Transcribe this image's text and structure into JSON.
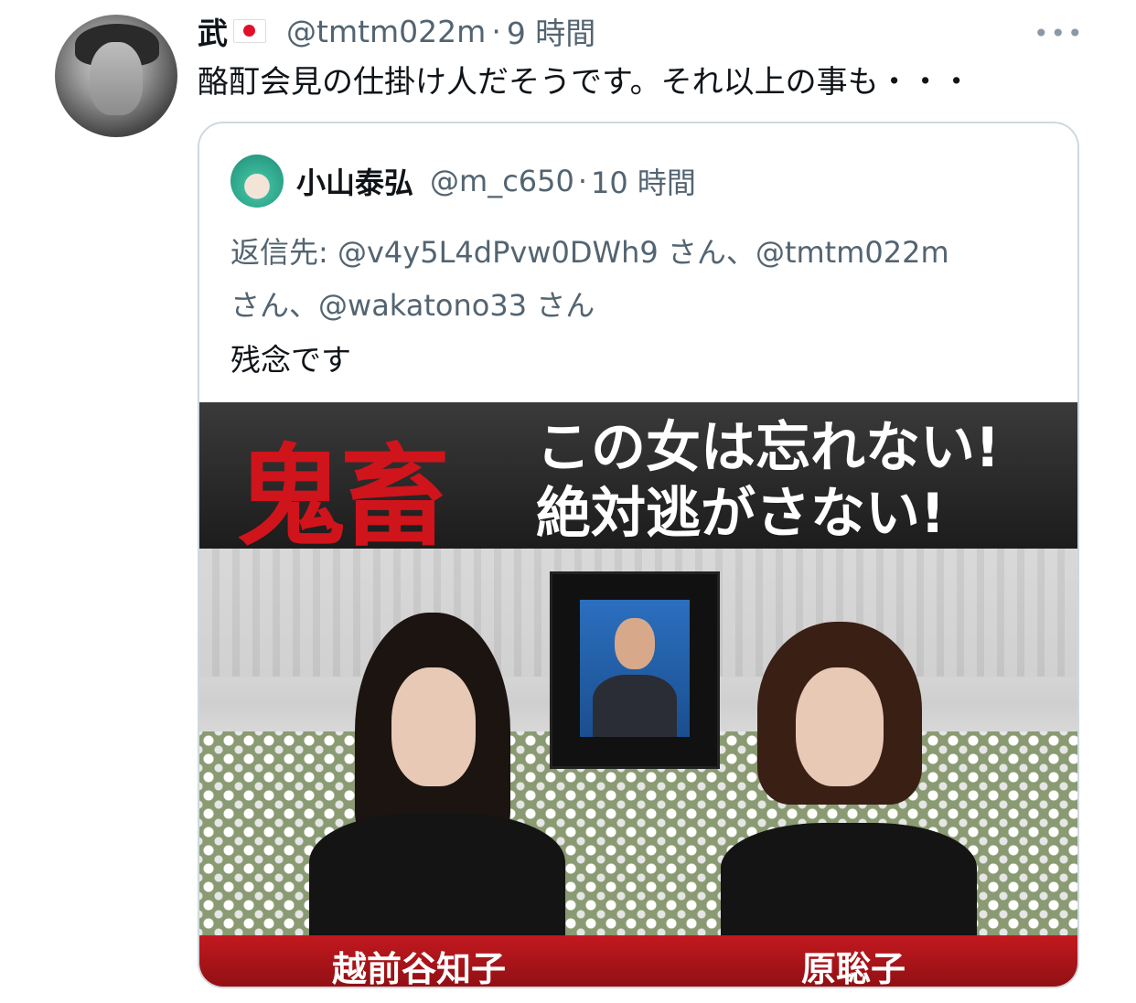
{
  "tweet": {
    "author_name": "武",
    "author_handle": "@tmtm022m",
    "separator": "·",
    "time": "9 時間",
    "text": "酪酊会見の仕掛け人だそうです。それ以上の事も・・・",
    "more_label": "•••"
  },
  "quoted_tweet": {
    "author_name": "小山泰弘",
    "author_handle": "@m_c650",
    "separator": "·",
    "time": "10 時間",
    "reply_prefix": "返信先: ",
    "mention_1": "@v4y5L4dPvw0DWh9",
    "san_1": " さん、",
    "mention_2": "@tmtm022m",
    "san_2": " さん、",
    "mention_3": "@wakatono33",
    "san_3": " さん",
    "text": "残念です"
  },
  "media": {
    "big_title": "鬼畜",
    "headline_line1": "この女は忘れない!",
    "headline_line2": "絶対逃がさない!",
    "caption_left": "越前谷知子",
    "caption_right": "原聡子",
    "title_color": "#d0141b",
    "caption_bar_color": "#c2191f"
  },
  "icons": {
    "flag": "japan-flag-icon",
    "more": "more-options-icon"
  }
}
